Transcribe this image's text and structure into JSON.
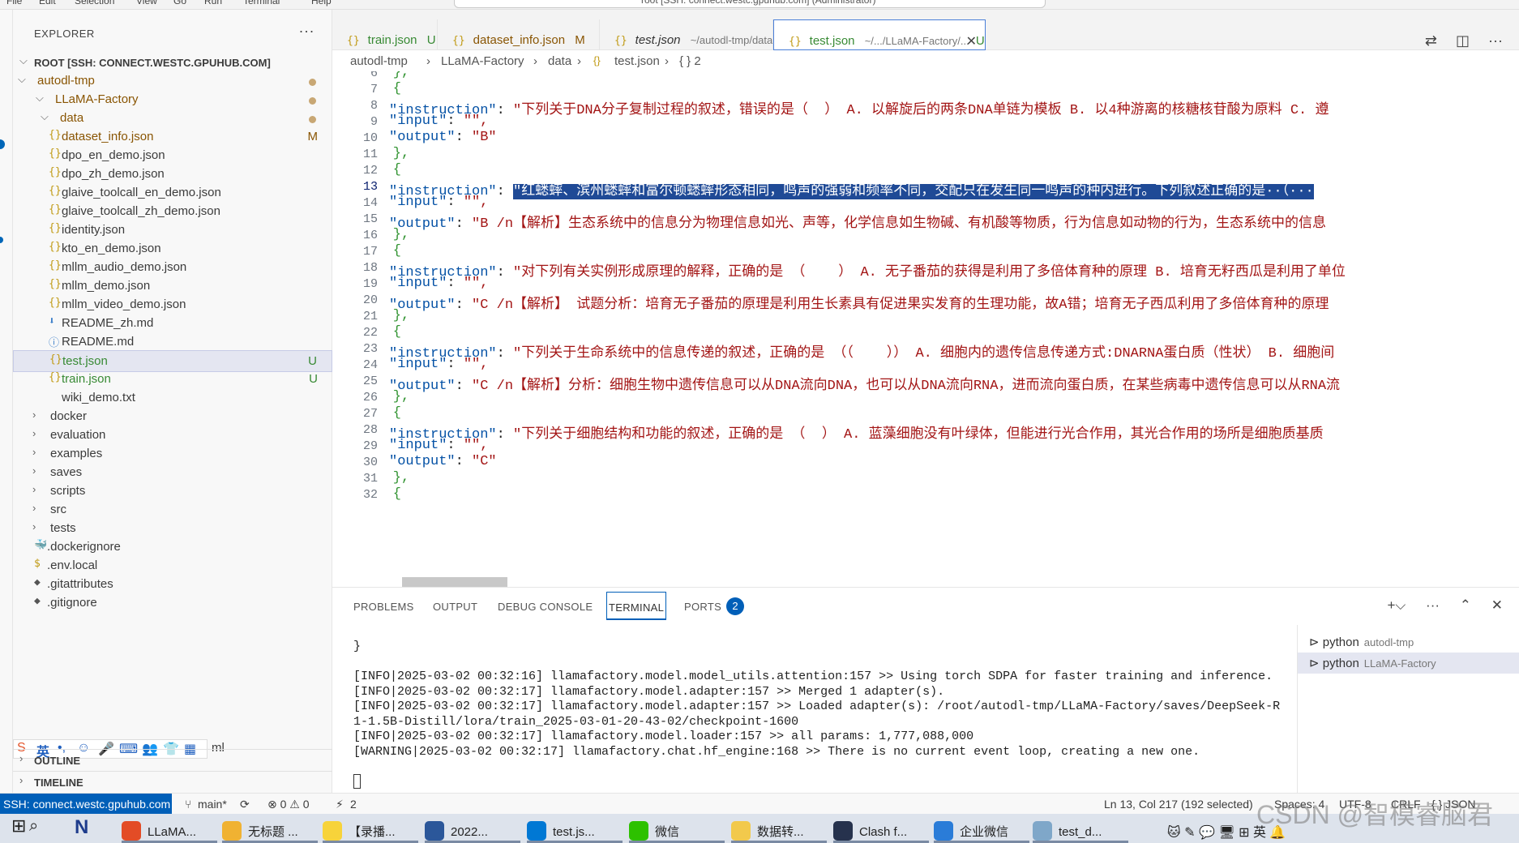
{
  "menubar": {
    "items": [
      "File",
      "Edit",
      "Selection",
      "View",
      "Go",
      "Run",
      "Terminal",
      "Help"
    ],
    "command_center": "root [SSH: connect.westc.gpuhub.com] (Administrator)"
  },
  "sidebar": {
    "title": "EXPLORER",
    "root": "ROOT [SSH: CONNECT.WESTC.GPUHUB.COM]",
    "tree": [
      {
        "label": "autodl-tmp",
        "kind": "folder-open",
        "badge": ""
      },
      {
        "label": "LLaMA-Factory",
        "kind": "folder-open",
        "badge": ""
      },
      {
        "label": "data",
        "kind": "folder-open",
        "badge": ""
      },
      {
        "label": "dataset_info.json",
        "kind": "json",
        "badge": "M"
      },
      {
        "label": "dpo_en_demo.json",
        "kind": "json",
        "badge": ""
      },
      {
        "label": "dpo_zh_demo.json",
        "kind": "json",
        "badge": ""
      },
      {
        "label": "glaive_toolcall_en_demo.json",
        "kind": "json",
        "badge": ""
      },
      {
        "label": "glaive_toolcall_zh_demo.json",
        "kind": "json",
        "badge": ""
      },
      {
        "label": "identity.json",
        "kind": "json",
        "badge": ""
      },
      {
        "label": "kto_en_demo.json",
        "kind": "json",
        "badge": ""
      },
      {
        "label": "mllm_audio_demo.json",
        "kind": "json",
        "badge": ""
      },
      {
        "label": "mllm_demo.json",
        "kind": "json",
        "badge": ""
      },
      {
        "label": "mllm_video_demo.json",
        "kind": "json",
        "badge": ""
      },
      {
        "label": "README_zh.md",
        "kind": "md",
        "badge": ""
      },
      {
        "label": "README.md",
        "kind": "info",
        "badge": ""
      },
      {
        "label": "test.json",
        "kind": "json",
        "badge": "U"
      },
      {
        "label": "train.json",
        "kind": "json",
        "badge": "U"
      },
      {
        "label": "wiki_demo.txt",
        "kind": "txt",
        "badge": ""
      },
      {
        "label": "docker",
        "kind": "folder",
        "badge": ""
      },
      {
        "label": "evaluation",
        "kind": "folder",
        "badge": ""
      },
      {
        "label": "examples",
        "kind": "folder",
        "badge": ""
      },
      {
        "label": "saves",
        "kind": "folder",
        "badge": ""
      },
      {
        "label": "scripts",
        "kind": "folder",
        "badge": ""
      },
      {
        "label": "src",
        "kind": "folder",
        "badge": ""
      },
      {
        "label": "tests",
        "kind": "folder",
        "badge": ""
      },
      {
        "label": ".dockerignore",
        "kind": "docker",
        "badge": ""
      },
      {
        "label": ".env.local",
        "kind": "env",
        "badge": ""
      },
      {
        "label": ".gitattributes",
        "kind": "git",
        "badge": ""
      },
      {
        "label": ".gitignore",
        "kind": "git",
        "badge": ""
      }
    ],
    "partial_item": "ml",
    "outline": "OUTLINE",
    "timeline": "TIMELINE"
  },
  "tabs": [
    {
      "label": "train.json",
      "desc": "",
      "badge": "U"
    },
    {
      "label": "dataset_info.json",
      "desc": "",
      "badge": "M"
    },
    {
      "label": "test.json",
      "desc": "~/autodl-tmp/data",
      "badge": ""
    },
    {
      "label": "test.json",
      "desc": "~/.../LLaMA-Factory/...",
      "badge": "U"
    }
  ],
  "breadcrumb": [
    "autodl-tmp",
    "LLaMA-Factory",
    "data",
    "test.json",
    "{ } 2"
  ],
  "editor": {
    "lines": [
      {
        "n": "6",
        "t": "    },"
      },
      {
        "n": "7",
        "t": "    {"
      },
      {
        "n": "8",
        "key": "\"instruction\"",
        "val": "\"下列关于DNA分子复制过程的叙述，错误的是（  ） A. 以解旋后的两条DNA单链为模板 B. 以4种游离的核糖核苷酸为原料 C. 遵"
      },
      {
        "n": "9",
        "key": "\"input\"",
        "val": "\"\","
      },
      {
        "n": "10",
        "key": "\"output\"",
        "val": "\"B\""
      },
      {
        "n": "11",
        "t": "    },"
      },
      {
        "n": "12",
        "t": "    {"
      },
      {
        "n": "13",
        "key": "\"instruction\"",
        "val": "\"红蟋蟀、滨州蟋蟀和富尔顿蟋蟀形态相同，鸣声的强弱和频率不同，交配只在发生同一鸣声的种内进行。下列叙述正确的是··（···",
        "selected": true
      },
      {
        "n": "14",
        "key": "\"input\"",
        "val": "\"\","
      },
      {
        "n": "15",
        "key": "\"output\"",
        "val": "\"B /n【解析】生态系统中的信息分为物理信息如光、声等，化学信息如生物碱、有机酸等物质，行为信息如动物的行为，生态系统中的信息"
      },
      {
        "n": "16",
        "t": "    },"
      },
      {
        "n": "17",
        "t": "    {"
      },
      {
        "n": "18",
        "key": "\"instruction\"",
        "val": "\"对下列有关实例形成原理的解释，正确的是 （    ） A. 无子番茄的获得是利用了多倍体育种的原理 B. 培育无籽西瓜是利用了单位"
      },
      {
        "n": "19",
        "key": "\"input\"",
        "val": "\"\","
      },
      {
        "n": "20",
        "key": "\"output\"",
        "val": "\"C /n【解析】 试题分析：培育无子番茄的原理是利用生长素具有促进果实发育的生理功能，故A错；培育无子西瓜利用了多倍体育种的原理"
      },
      {
        "n": "21",
        "t": "    },"
      },
      {
        "n": "22",
        "t": "    {"
      },
      {
        "n": "23",
        "key": "\"instruction\"",
        "val": "\"下列关于生命系统中的信息传递的叙述，正确的是 （（    ）） A. 细胞内的遗传信息传递方式:DNARNA蛋白质（性状） B. 细胞间"
      },
      {
        "n": "24",
        "key": "\"input\"",
        "val": "\"\","
      },
      {
        "n": "25",
        "key": "\"output\"",
        "val": "\"C /n【解析】分析：细胞生物中遗传信息可以从DNA流向DNA，也可以从DNA流向RNA，进而流向蛋白质，在某些病毒中遗传信息可以从RNA流"
      },
      {
        "n": "26",
        "t": "    },"
      },
      {
        "n": "27",
        "t": "    {"
      },
      {
        "n": "28",
        "key": "\"instruction\"",
        "val": "\"下列关于细胞结构和功能的叙述，正确的是 （  ） A. 蓝藻细胞没有叶绿体，但能进行光合作用，其光合作用的场所是细胞质基质"
      },
      {
        "n": "29",
        "key": "\"input\"",
        "val": "\"\","
      },
      {
        "n": "30",
        "key": "\"output\"",
        "val": "\"C\""
      },
      {
        "n": "31",
        "t": "    },"
      },
      {
        "n": "32",
        "t": "    {"
      }
    ]
  },
  "panel": {
    "tabs": [
      "PROBLEMS",
      "OUTPUT",
      "DEBUG CONSOLE",
      "TERMINAL",
      "PORTS"
    ],
    "ports_count": "2",
    "terminal_lines": [
      "}",
      "",
      "[INFO|2025-03-02 00:32:16] llamafactory.model.model_utils.attention:157 >> Using torch SDPA for faster training and inference.",
      "[INFO|2025-03-02 00:32:17] llamafactory.model.adapter:157 >> Merged 1 adapter(s).",
      "[INFO|2025-03-02 00:32:17] llamafactory.model.adapter:157 >> Loaded adapter(s): /root/autodl-tmp/LLaMA-Factory/saves/DeepSeek-R",
      "1-1.5B-Distill/lora/train_2025-03-01-20-43-02/checkpoint-1600",
      "[INFO|2025-03-02 00:32:17] llamafactory.model.loader:157 >> all params: 1,777,088,000",
      "[WARNING|2025-03-02 00:32:17] llamafactory.chat.hf_engine:168 >> There is no current event loop, creating a new one."
    ],
    "terminals": [
      {
        "name": "python",
        "desc": "autodl-tmp"
      },
      {
        "name": "python",
        "desc": "LLaMA-Factory"
      }
    ]
  },
  "status": {
    "remote": "SSH: connect.westc.gpuhub.com",
    "branch": "main*",
    "problems": "⊗ 0 ⚠ 0",
    "ports": "2",
    "cursor": "Ln 13, Col 217 (192 selected)",
    "spaces": "Spaces: 4",
    "encoding": "UTF-8",
    "eol": "CRLF",
    "language": "{ } JSON"
  },
  "taskbar": [
    {
      "label": "LLaMA...",
      "color": "#e34c26"
    },
    {
      "label": "无标题 ...",
      "color": "#f0b232"
    },
    {
      "label": "【录播...",
      "color": "#f7d33a"
    },
    {
      "label": "2022...",
      "color": "#2b579a"
    },
    {
      "label": "test.js...",
      "color": "#0078d4"
    },
    {
      "label": "微信",
      "color": "#2dc100"
    },
    {
      "label": "数据转...",
      "color": "#f2c94c"
    },
    {
      "label": "Clash f...",
      "color": "#26324d"
    },
    {
      "label": "企业微信",
      "color": "#2a7cd8"
    },
    {
      "label": "test_d...",
      "color": "#7fa7c9"
    }
  ],
  "watermark": "CSDN @智模睿脑君"
}
